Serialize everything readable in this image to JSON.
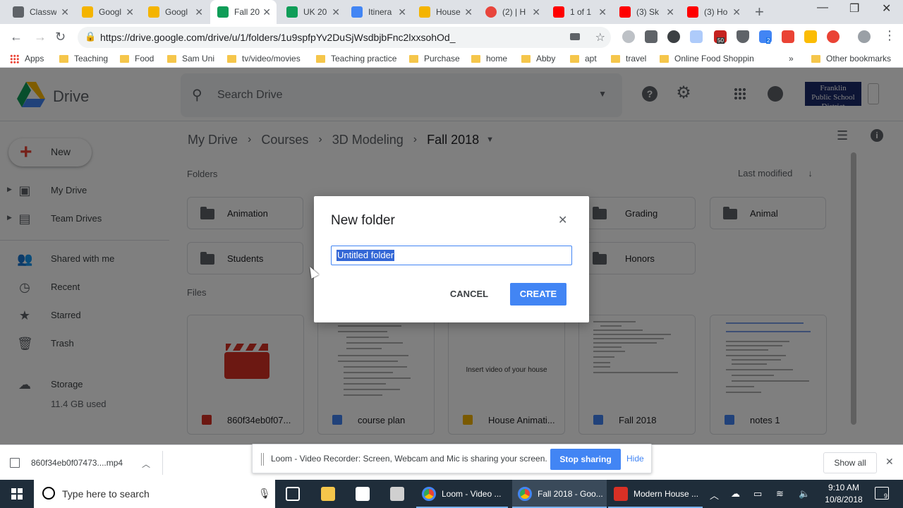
{
  "browser": {
    "tabs": [
      {
        "title": "Classw",
        "color": "#5f6368"
      },
      {
        "title": "Googl",
        "color": "#f4b400"
      },
      {
        "title": "Googl",
        "color": "#f4b400"
      },
      {
        "title": "Fall 20",
        "color": "#0f9d58",
        "active": true
      },
      {
        "title": "UK 20",
        "color": "#0f9d58"
      },
      {
        "title": "Itinera",
        "color": "#4285f4"
      },
      {
        "title": "House",
        "color": "#f4b400"
      },
      {
        "title": "(2) | H",
        "color": "#e8453c"
      },
      {
        "title": "1 of 1",
        "color": "#ff0000"
      },
      {
        "title": "(3) Sk",
        "color": "#ff0000"
      },
      {
        "title": "(3) Ho",
        "color": "#ff0000"
      }
    ],
    "url": "https://drive.google.com/drive/u/1/folders/1u9spfpYv2DuSjWsdbjbFnc2lxxsohOd_",
    "bookmarks": [
      "Apps",
      "Teaching",
      "Food",
      "Sam Uni",
      "tv/video/movies",
      "Teaching practice",
      "Purchase",
      "home",
      "Abby",
      "apt",
      "travel",
      "Online Food Shoppin"
    ],
    "bookmarks_more": "»",
    "other_bookmarks": "Other bookmarks",
    "ext_badge_1": "50",
    "ext_badge_2": "2"
  },
  "drive": {
    "app_name": "Drive",
    "search_placeholder": "Search Drive",
    "account_logo_text": "Franklin\nPublic School District",
    "new_label": "New",
    "nav": [
      {
        "label": "My Drive",
        "icon": "my-drive-icon",
        "expandable": true
      },
      {
        "label": "Team Drives",
        "icon": "team-drives-icon",
        "expandable": true
      },
      {
        "label": "Shared with me",
        "icon": "shared-icon"
      },
      {
        "label": "Recent",
        "icon": "clock-icon"
      },
      {
        "label": "Starred",
        "icon": "star-icon"
      },
      {
        "label": "Trash",
        "icon": "trash-icon"
      },
      {
        "label": "Storage",
        "icon": "cloud-icon"
      }
    ],
    "storage_used": "11.4 GB used",
    "breadcrumb": [
      "My Drive",
      "Courses",
      "3D Modeling",
      "Fall 2018"
    ],
    "folders_label": "Folders",
    "files_label": "Files",
    "sort_label": "Last modified",
    "folders": [
      "Animation",
      "Grading",
      "Animal",
      "Students",
      "Honors"
    ],
    "files": [
      {
        "name": "860f34eb0f07...",
        "type": "video",
        "color": "#d93025"
      },
      {
        "name": "course plan",
        "type": "doc",
        "color": "#4285f4"
      },
      {
        "name": "House Animati...",
        "type": "slides",
        "color": "#f4b400",
        "thumb_text": "Insert video of your house"
      },
      {
        "name": "Fall 2018",
        "type": "doc",
        "color": "#4285f4"
      },
      {
        "name": "notes 1",
        "type": "doc",
        "color": "#4285f4"
      }
    ]
  },
  "dialog": {
    "title": "New folder",
    "input_value": "Untitled folder",
    "cancel_label": "CANCEL",
    "create_label": "CREATE"
  },
  "downloads": {
    "file_name": "860f34eb0f07473....mp4",
    "show_all": "Show all"
  },
  "loom": {
    "message": "Loom - Video Recorder: Screen, Webcam and Mic is sharing your screen.",
    "stop_label": "Stop sharing",
    "hide_label": "Hide"
  },
  "taskbar": {
    "search_placeholder": "Type here to search",
    "apps": [
      {
        "label": "Loom - Video ...",
        "color": "#4285f4"
      },
      {
        "label": "Fall 2018 - Goo...",
        "color": "#4285f4",
        "active": true
      },
      {
        "label": "Modern House ...",
        "color": "#d93025"
      }
    ],
    "time": "9:10 AM",
    "date": "10/8/2018",
    "notification_count": "9"
  }
}
